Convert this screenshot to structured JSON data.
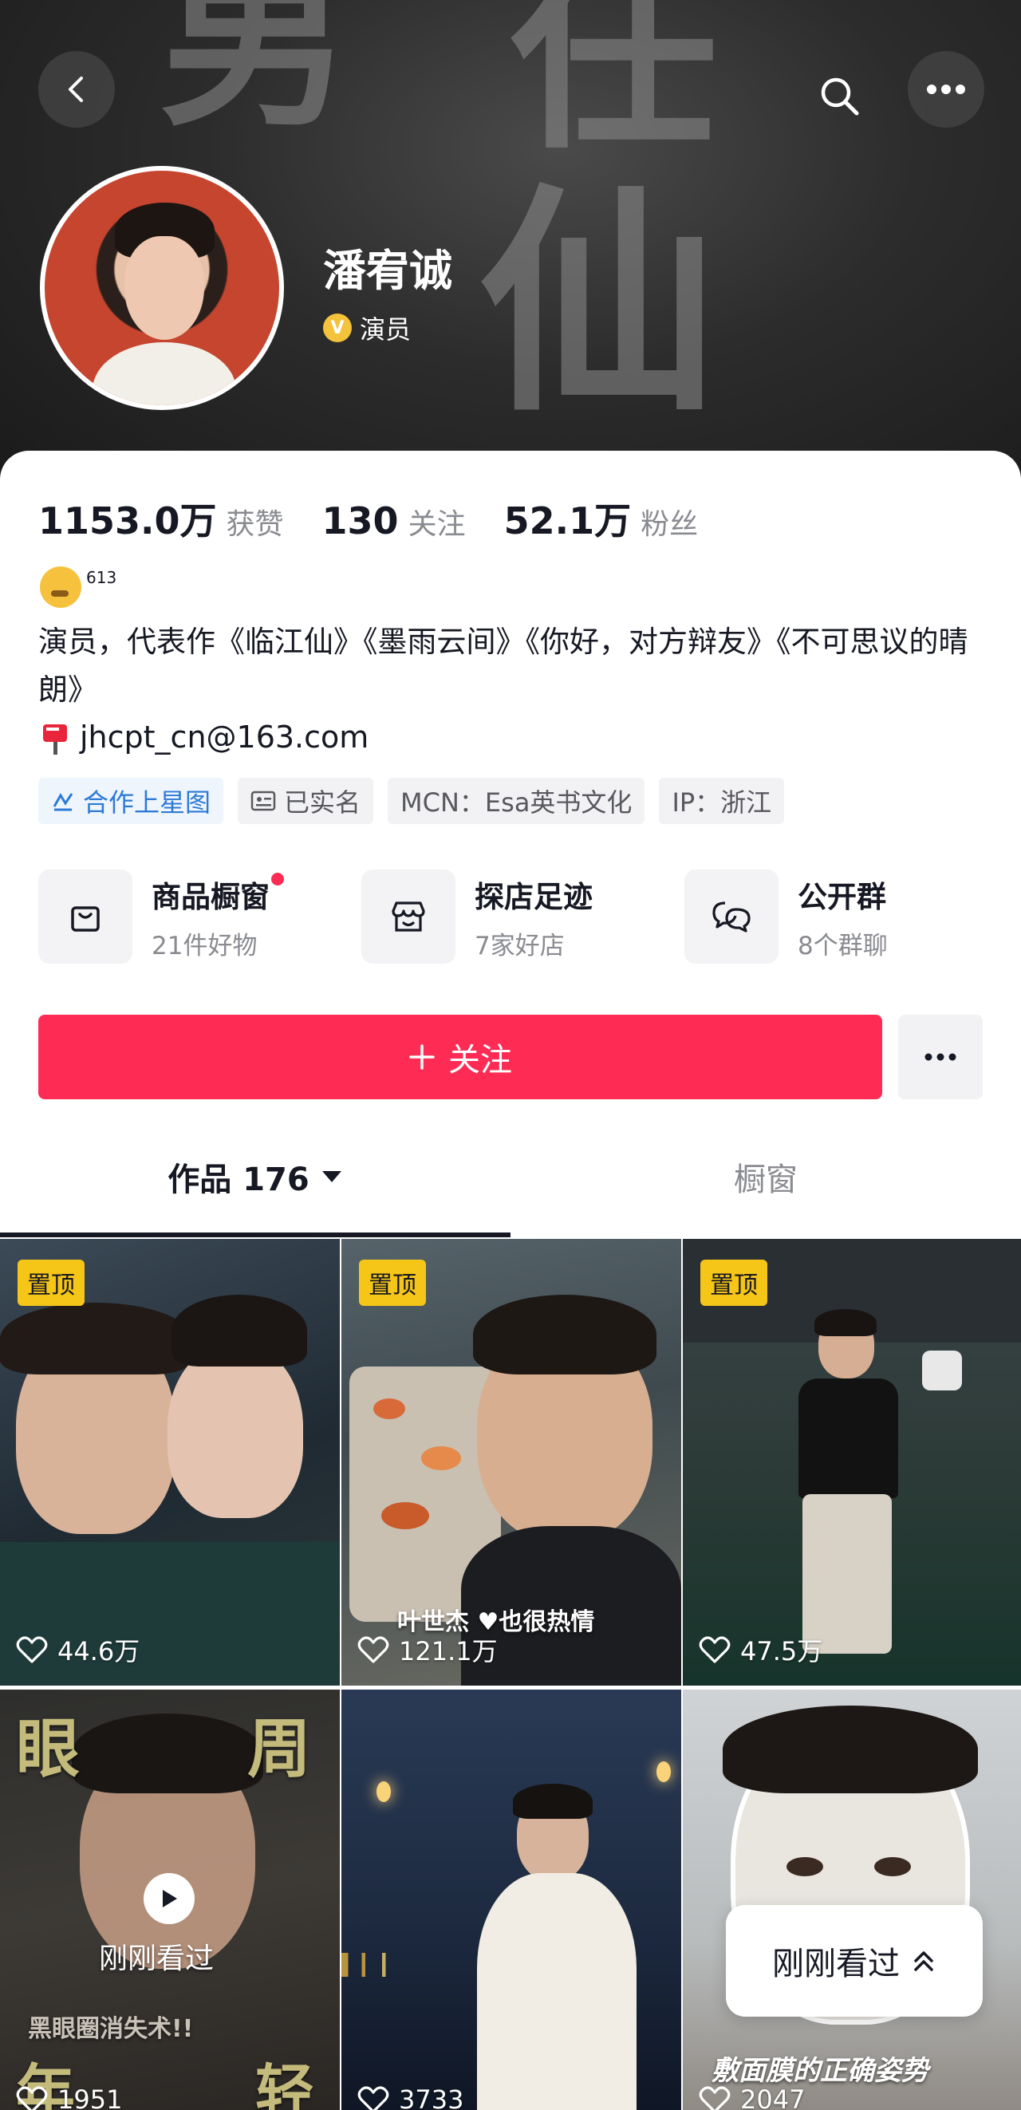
{
  "header": {
    "name": "潘宥诚",
    "verify_badge": "V",
    "verify_title": "演员",
    "calligraphy": [
      "男",
      "任",
      "仙"
    ]
  },
  "stats": [
    {
      "value": "1153.0万",
      "label": "获赞"
    },
    {
      "value": "130",
      "label": "关注"
    },
    {
      "value": "52.1万",
      "label": "粉丝"
    }
  ],
  "emoji_count": "613",
  "bio": "演员，代表作《临江仙》《墨雨云间》《你好，对方辩友》《不可思议的晴朗》",
  "email": "jhcpt_cn@163.com",
  "tags": [
    {
      "label": "合作上星图",
      "icon": "xingtu-icon"
    },
    {
      "label": "已实名",
      "icon": "id-card-icon"
    },
    {
      "label": "MCN：Esa英书文化",
      "icon": ""
    },
    {
      "label": "IP：浙江",
      "icon": ""
    }
  ],
  "shortcuts": [
    {
      "title": "商品橱窗",
      "sub": "21件好物",
      "icon": "shopping-bag-icon",
      "dot": true
    },
    {
      "title": "探店足迹",
      "sub": "7家好店",
      "icon": "store-icon",
      "dot": false
    },
    {
      "title": "公开群",
      "sub": "8个群聊",
      "icon": "chat-group-icon",
      "dot": false
    }
  ],
  "follow_label": "关注",
  "tabs": {
    "works": "作品 176",
    "showcase": "橱窗"
  },
  "videos": [
    {
      "pinned": "置顶",
      "likes": "44.6万"
    },
    {
      "pinned": "置顶",
      "likes": "121.1万",
      "caption": "叶世杰 ♥也很热情"
    },
    {
      "pinned": "置顶",
      "likes": "47.5万"
    },
    {
      "overlay": "刚刚看过",
      "top_text_left": "眼",
      "top_text_right": "周",
      "caption": "黑眼圈消失术!!",
      "likes": "1951",
      "bottom_left": "年",
      "bottom_right": "轻"
    },
    {
      "likes": "3733"
    },
    {
      "caption": "敷面膜的正确姿势",
      "likes": "2047"
    }
  ],
  "recent_pill": "刚刚看过",
  "colors": {
    "accent": "#fe2c55",
    "pin": "#f5c518",
    "verify": "#f3c33b"
  }
}
